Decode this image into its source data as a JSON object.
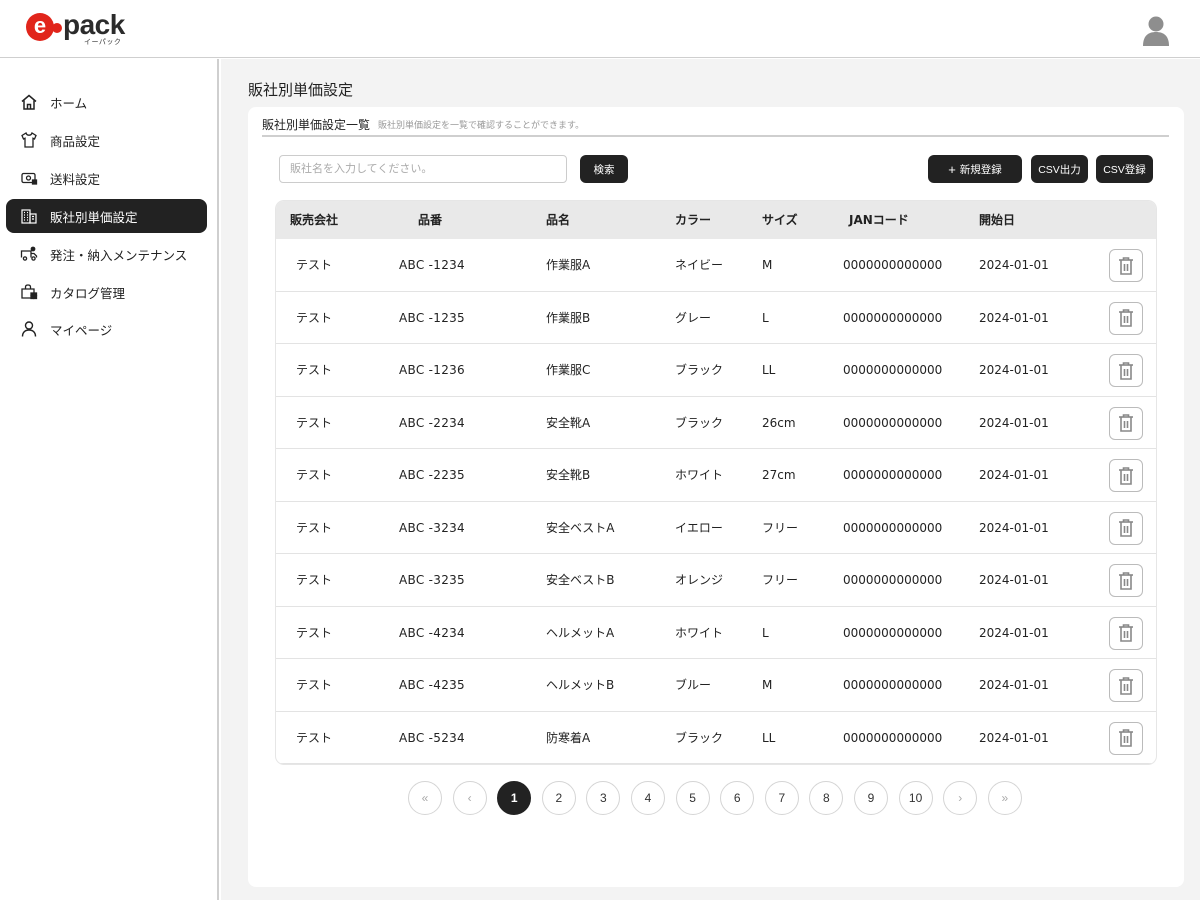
{
  "app": {
    "logo_text": "pack",
    "logo_sub": "イーパック"
  },
  "sidebar": {
    "items": [
      {
        "label": "ホーム",
        "icon": "home-icon"
      },
      {
        "label": "商品設定",
        "icon": "shirt-icon"
      },
      {
        "label": "送料設定",
        "icon": "shipping-fee-icon"
      },
      {
        "label": "販社別単価設定",
        "icon": "building-icon",
        "active": true
      },
      {
        "label": "発注・納入メンテナンス",
        "icon": "truck-icon"
      },
      {
        "label": "カタログ管理",
        "icon": "catalog-icon"
      },
      {
        "label": "マイページ",
        "icon": "user-icon"
      }
    ]
  },
  "page": {
    "title": "販社別単価設定",
    "card_title": "販社別単価設定一覧",
    "card_desc": "販社別単価設定を一覧で確認することができます。"
  },
  "toolbar": {
    "search_placeholder": "販社名を入力してください。",
    "search_label": "検索",
    "new_label": "新規登録",
    "csv_out_label": "CSV出力",
    "csv_in_label": "CSV登録"
  },
  "table": {
    "headers": [
      "販売会社",
      "品番",
      "品名",
      "カラー",
      "サイズ",
      "JANコード",
      "開始日"
    ],
    "rows": [
      {
        "company": "テスト",
        "code": "ABC -1234",
        "name": "作業服A",
        "color": "ネイビー",
        "size": "M",
        "jan": "0000000000000",
        "date": "2024-01-01"
      },
      {
        "company": "テスト",
        "code": "ABC -1235",
        "name": "作業服B",
        "color": "グレー",
        "size": "L",
        "jan": "0000000000000",
        "date": "2024-01-01"
      },
      {
        "company": "テスト",
        "code": "ABC -1236",
        "name": "作業服C",
        "color": "ブラック",
        "size": "LL",
        "jan": "0000000000000",
        "date": "2024-01-01"
      },
      {
        "company": "テスト",
        "code": "ABC -2234",
        "name": "安全靴A",
        "color": "ブラック",
        "size": "26cm",
        "jan": "0000000000000",
        "date": "2024-01-01"
      },
      {
        "company": "テスト",
        "code": "ABC -2235",
        "name": "安全靴B",
        "color": "ホワイト",
        "size": "27cm",
        "jan": "0000000000000",
        "date": "2024-01-01"
      },
      {
        "company": "テスト",
        "code": "ABC -3234",
        "name": "安全ベストA",
        "color": "イエロー",
        "size": "フリー",
        "jan": "0000000000000",
        "date": "2024-01-01"
      },
      {
        "company": "テスト",
        "code": "ABC -3235",
        "name": "安全ベストB",
        "color": "オレンジ",
        "size": "フリー",
        "jan": "0000000000000",
        "date": "2024-01-01"
      },
      {
        "company": "テスト",
        "code": "ABC -4234",
        "name": "ヘルメットA",
        "color": "ホワイト",
        "size": "L",
        "jan": "0000000000000",
        "date": "2024-01-01"
      },
      {
        "company": "テスト",
        "code": "ABC -4235",
        "name": "ヘルメットB",
        "color": "ブルー",
        "size": "M",
        "jan": "0000000000000",
        "date": "2024-01-01"
      },
      {
        "company": "テスト",
        "code": "ABC -5234",
        "name": "防寒着A",
        "color": "ブラック",
        "size": "LL",
        "jan": "0000000000000",
        "date": "2024-01-01"
      }
    ]
  },
  "pagination": {
    "first": "«",
    "prev": "‹",
    "pages": [
      "1",
      "2",
      "3",
      "4",
      "5",
      "6",
      "7",
      "8",
      "9",
      "10"
    ],
    "current": "1",
    "next": "›",
    "last": "»"
  },
  "colors": {
    "accent": "#222222",
    "brand_red": "#e1251b",
    "background": "#f3f3f3"
  }
}
